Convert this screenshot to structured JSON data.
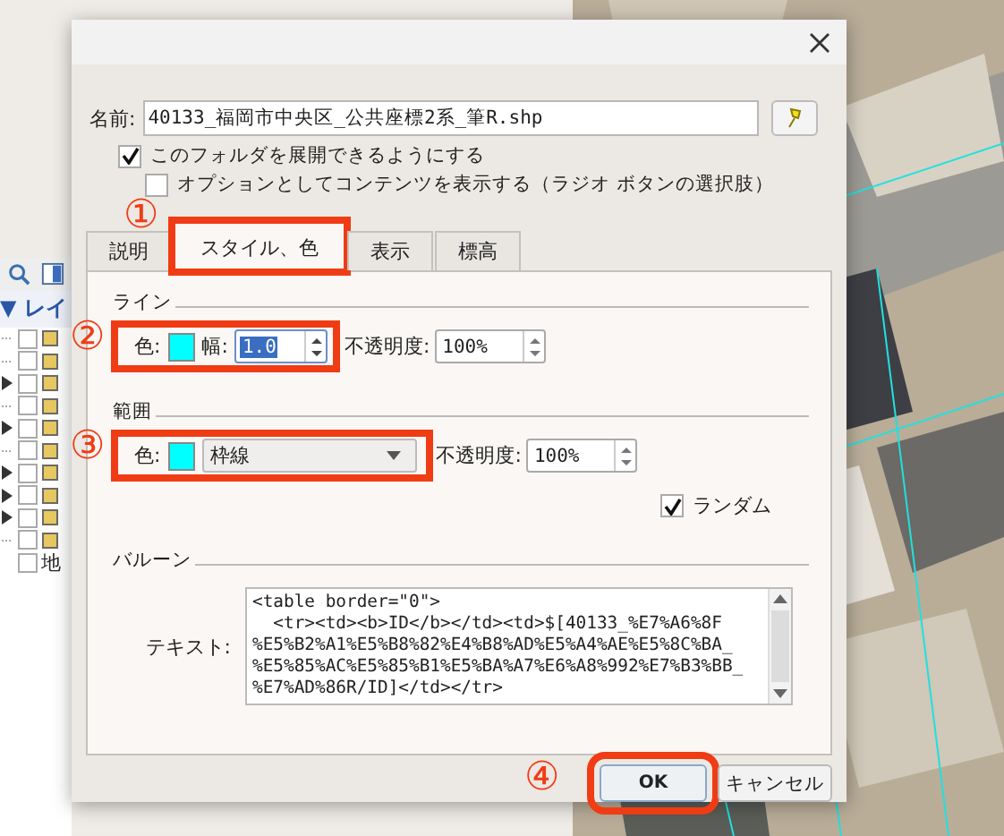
{
  "layers_panel": {
    "title": "▼ レイ",
    "items": [
      {
        "expandable": false,
        "checked": false
      },
      {
        "expandable": false,
        "checked": false
      },
      {
        "expandable": true,
        "checked": false
      },
      {
        "expandable": false,
        "checked": false
      },
      {
        "expandable": true,
        "checked": false
      },
      {
        "expandable": false,
        "checked": false
      },
      {
        "expandable": true,
        "checked": false
      },
      {
        "expandable": true,
        "checked": false
      },
      {
        "expandable": true,
        "checked": false
      },
      {
        "expandable": false,
        "checked": false
      }
    ],
    "last_item": {
      "label": "地",
      "checked": false
    }
  },
  "dialog": {
    "name_label": "名前:",
    "name_value": "40133_福岡市中央区_公共座標2系_筆R.shp",
    "options": [
      {
        "label": "このフォルダを展開できるようにする",
        "checked": true,
        "indent": false
      },
      {
        "label": "オプションとしてコンテンツを表示する（ラジオ ボタンの選択肢）",
        "checked": false,
        "indent": true
      }
    ],
    "tabs": [
      {
        "label": "説明",
        "selected": false,
        "highlighted": false
      },
      {
        "label": "スタイル、色",
        "selected": true,
        "highlighted": true,
        "marker": "①"
      },
      {
        "label": "表示",
        "selected": false,
        "highlighted": false
      },
      {
        "label": "標高",
        "selected": false,
        "highlighted": false
      }
    ],
    "line": {
      "title": "ライン",
      "highlighted": true,
      "marker": "②",
      "color_label": "色:",
      "color": "#00ffff",
      "width_label": "幅:",
      "width_value": "1.0",
      "width_text_selected": true,
      "opacity_label": "不透明度:",
      "opacity_value": "100%"
    },
    "area": {
      "title": "範囲",
      "highlighted": true,
      "marker": "③",
      "color_label": "色:",
      "color": "#00ffff",
      "style_value": "枠線",
      "opacity_label": "不透明度:",
      "opacity_value": "100%",
      "random": {
        "label": "ランダム",
        "checked": true
      }
    },
    "balloon": {
      "title": "バルーン",
      "text_label": "テキスト:",
      "text_lines": [
        "<table border=\"0\">",
        "  <tr><td><b>ID</b></td><td>$[40133_%E7%A6%8F",
        "%E5%B2%A1%E5%B8%82%E4%B8%AD%E5%A4%AE%E5%8C%BA_",
        "%E5%85%AC%E5%85%B1%E5%BA%A7%E6%A8%992%E7%B3%BB_",
        "%E7%AD%86R/ID]</td></tr>"
      ]
    },
    "buttons": [
      {
        "label": "OK",
        "kind": "default",
        "highlighted": true,
        "marker": "④"
      },
      {
        "label": "キャンセル",
        "kind": "normal",
        "highlighted": false
      }
    ]
  }
}
